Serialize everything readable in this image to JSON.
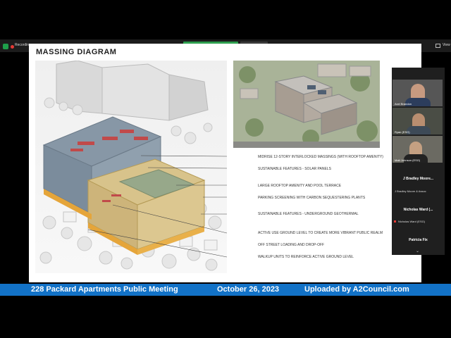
{
  "toolbar": {
    "recording_label": "Recording",
    "viewing_banner": "You are viewing Will Brandon's screen",
    "view_options_label": "View Options",
    "view_label": "View"
  },
  "slide": {
    "title": "MASSING DIAGRAM",
    "legend": [
      "MIDRISE 12-STORY INTERLOCKED MASSINGS (WITH ROOFTOP AMENITY)",
      "SUSTAINABLE FEATURES - SOLAR PANELS",
      "LARGE ROOFTOP AMENITY AND POOL TERRACE",
      "PARKING SCREENING WITH CARBON SEQUESTERING PLANTS",
      "SUSTAINABLE FEATURES - UNDERGROUND GEOTHERMAL",
      "ACTIVE USE GROUND LEVEL TO CREATE MORE VIBRANT PUBLIC REALM",
      "OFF STREET LOADING AND DROP-OFF",
      "WALKUP UNITS TO REINFORCE ACTIVE GROUND LEVEL"
    ]
  },
  "participants": {
    "videos": [
      {
        "name": "Axel Brandon"
      },
      {
        "name": "Ryan (ESG)"
      },
      {
        "name": "Matt Johnson (ESG)"
      }
    ],
    "list": [
      {
        "display": "J Bradley Moore...",
        "sub": "J Bradley Moore & Assoc"
      },
      {
        "display": "Nicholas Ward (...",
        "sub": "Nicholas Ward (ESG)"
      },
      {
        "display": "Patricia Fix",
        "sub": ""
      }
    ]
  },
  "banner": {
    "title": "228 Packard Apartments Public Meeting",
    "date": "October 26, 2023",
    "credit": "Uploaded by A2Council.com"
  }
}
